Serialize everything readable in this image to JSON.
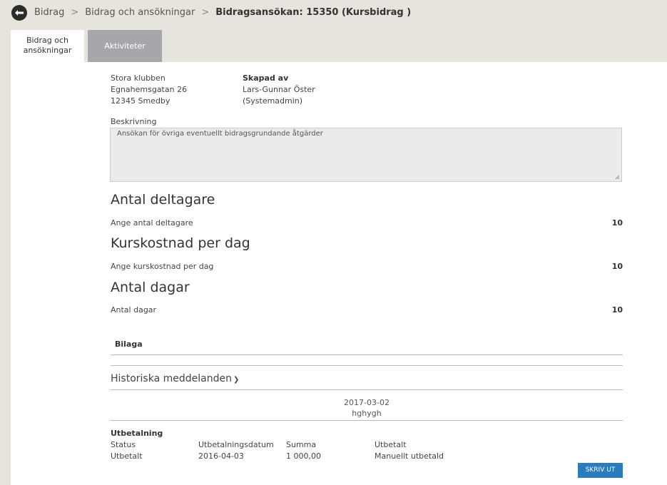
{
  "breadcrumb": {
    "items": [
      "Bidrag",
      "Bidrag och ansökningar"
    ],
    "separator": ">",
    "current": "Bidragsansökan: 15350 (Kursbidrag )"
  },
  "tabs": {
    "active_line1": "Bidrag och",
    "active_line2": "ansökningar",
    "inactive": "Aktiviteter"
  },
  "applicant": {
    "name": "Stora klubben",
    "street": "Egnahemsgatan 26",
    "postal": "12345 Smedby"
  },
  "created_by": {
    "heading": "Skapad av",
    "name": "Lars-Gunnar Öster",
    "role": "(Systemadmin)"
  },
  "description": {
    "label": "Beskrivning",
    "value": "Ansökan för övriga eventuellt bidragsgrundande åtgärder"
  },
  "sections": [
    {
      "heading": "Antal deltagare",
      "label": "Ange antal deltagare",
      "value": "10"
    },
    {
      "heading": "Kurskostnad per dag",
      "label": "Ange kurskostnad per dag",
      "value": "10"
    },
    {
      "heading": "Antal dagar",
      "label": "Antal dagar",
      "value": "10"
    }
  ],
  "attachment": {
    "heading": "Bilaga"
  },
  "history": {
    "heading": "Historiska meddelanden",
    "messages": [
      {
        "date": "2017-03-02",
        "text": "hghygh"
      }
    ]
  },
  "payment": {
    "heading": "Utbetalning",
    "columns": [
      "Status",
      "Utbetalningsdatum",
      "Summa",
      "Utbetalt"
    ],
    "row": [
      "Utbetalt",
      "2016-04-03",
      "1 000,00",
      "Manuellt utbetald"
    ]
  },
  "print_button": "SKRIV UT",
  "colors": {
    "accent": "#2b7bbd",
    "background": "#e6e4dc",
    "tab_inactive": "#a5a7ab"
  }
}
